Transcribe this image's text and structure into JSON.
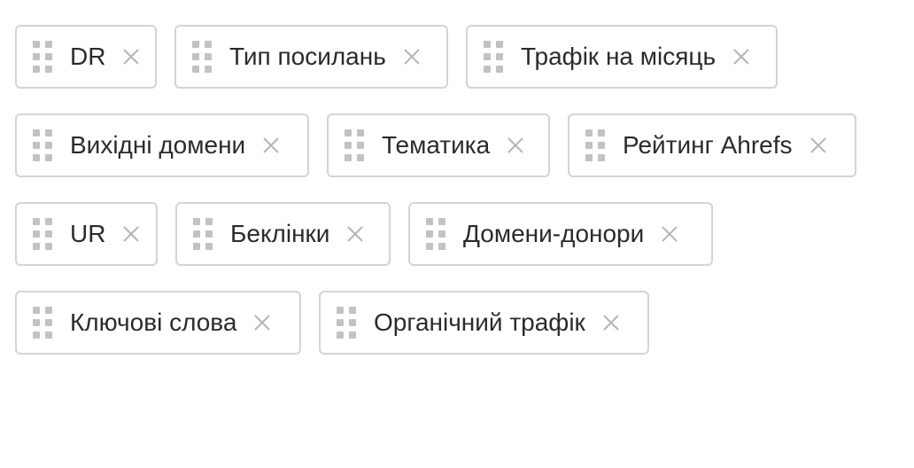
{
  "colors": {
    "chip_border": "#d4d4d4",
    "handle_dots": "#c2c2c2",
    "close_icon": "#b5b5b5",
    "text": "#2b2b2b"
  },
  "icons": {
    "handle": "drag-handle-icon",
    "close": "close-icon"
  },
  "chips": [
    {
      "label": "DR"
    },
    {
      "label": "Тип посилань"
    },
    {
      "label": "Трафік на місяць"
    },
    {
      "label": "Вихідні домени"
    },
    {
      "label": "Тематика"
    },
    {
      "label": "Рейтинг Ahrefs"
    },
    {
      "label": "UR"
    },
    {
      "label": "Беклінки"
    },
    {
      "label": "Домени-донори"
    },
    {
      "label": "Ключові слова"
    },
    {
      "label": "Органічний трафік"
    }
  ]
}
